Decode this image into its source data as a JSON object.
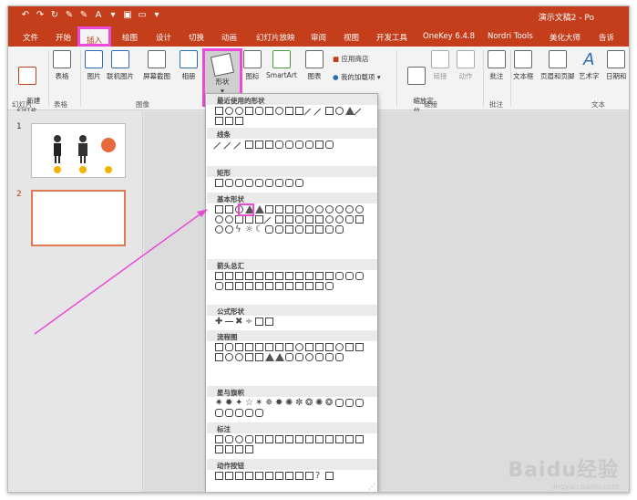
{
  "titlebar": {
    "doc_title": "演示文稿2 - Po",
    "qat": [
      "↶",
      "↷",
      "↻",
      "✎",
      "✎",
      "A",
      "▾",
      "▣",
      "▭",
      "▾"
    ],
    "help_icon": "lightbulb-icon"
  },
  "tabs": [
    {
      "label": "文件"
    },
    {
      "label": "开始"
    },
    {
      "label": "插入",
      "active": true
    },
    {
      "label": "绘图"
    },
    {
      "label": "设计"
    },
    {
      "label": "切换"
    },
    {
      "label": "动画"
    },
    {
      "label": "幻灯片放映"
    },
    {
      "label": "审阅"
    },
    {
      "label": "视图"
    },
    {
      "label": "开发工具"
    },
    {
      "label": "OneKey 6.4.8"
    },
    {
      "label": "Nordri Tools"
    },
    {
      "label": "美化大师"
    },
    {
      "label": "告诉"
    }
  ],
  "ribbon": {
    "new_slide": "新建\n幻灯片",
    "table": "表格",
    "picture": "图片",
    "online_picture": "联机图片",
    "screenshot": "屏幕截图",
    "album": "相册",
    "shapes": "形状",
    "icons": "图标",
    "smartart": "SmartArt",
    "chart": "图表",
    "store": "应用商店",
    "my_addins": "我的加载项",
    "zoom": "缩放定\n位",
    "link": "链接",
    "action": "动作",
    "comment": "批注",
    "textbox": "文本框",
    "header_footer": "页眉和页脚",
    "wordart": "艺术字",
    "date_time": "日期和",
    "groups": {
      "slides": "幻灯片",
      "tables": "表格",
      "images": "图像",
      "links": "链接",
      "comments": "批注",
      "text": "文本"
    }
  },
  "thumbnails": [
    {
      "number": "1"
    },
    {
      "number": "2"
    }
  ],
  "dropdown": {
    "sections": {
      "recent": "最近使用的形状",
      "lines": "线条",
      "rect": "矩形",
      "basic": "基本形状",
      "arrows": "箭头总汇",
      "equation": "公式形状",
      "flowchart": "流程图",
      "stars": "星与旗帜",
      "callouts": "标注",
      "action_buttons": "动作按钮"
    }
  },
  "watermark": {
    "brand": "Baidu经验",
    "url": "jingyan.baidu.com"
  },
  "colors": {
    "accent": "#c43e1c",
    "highlight": "#e94bd8"
  }
}
